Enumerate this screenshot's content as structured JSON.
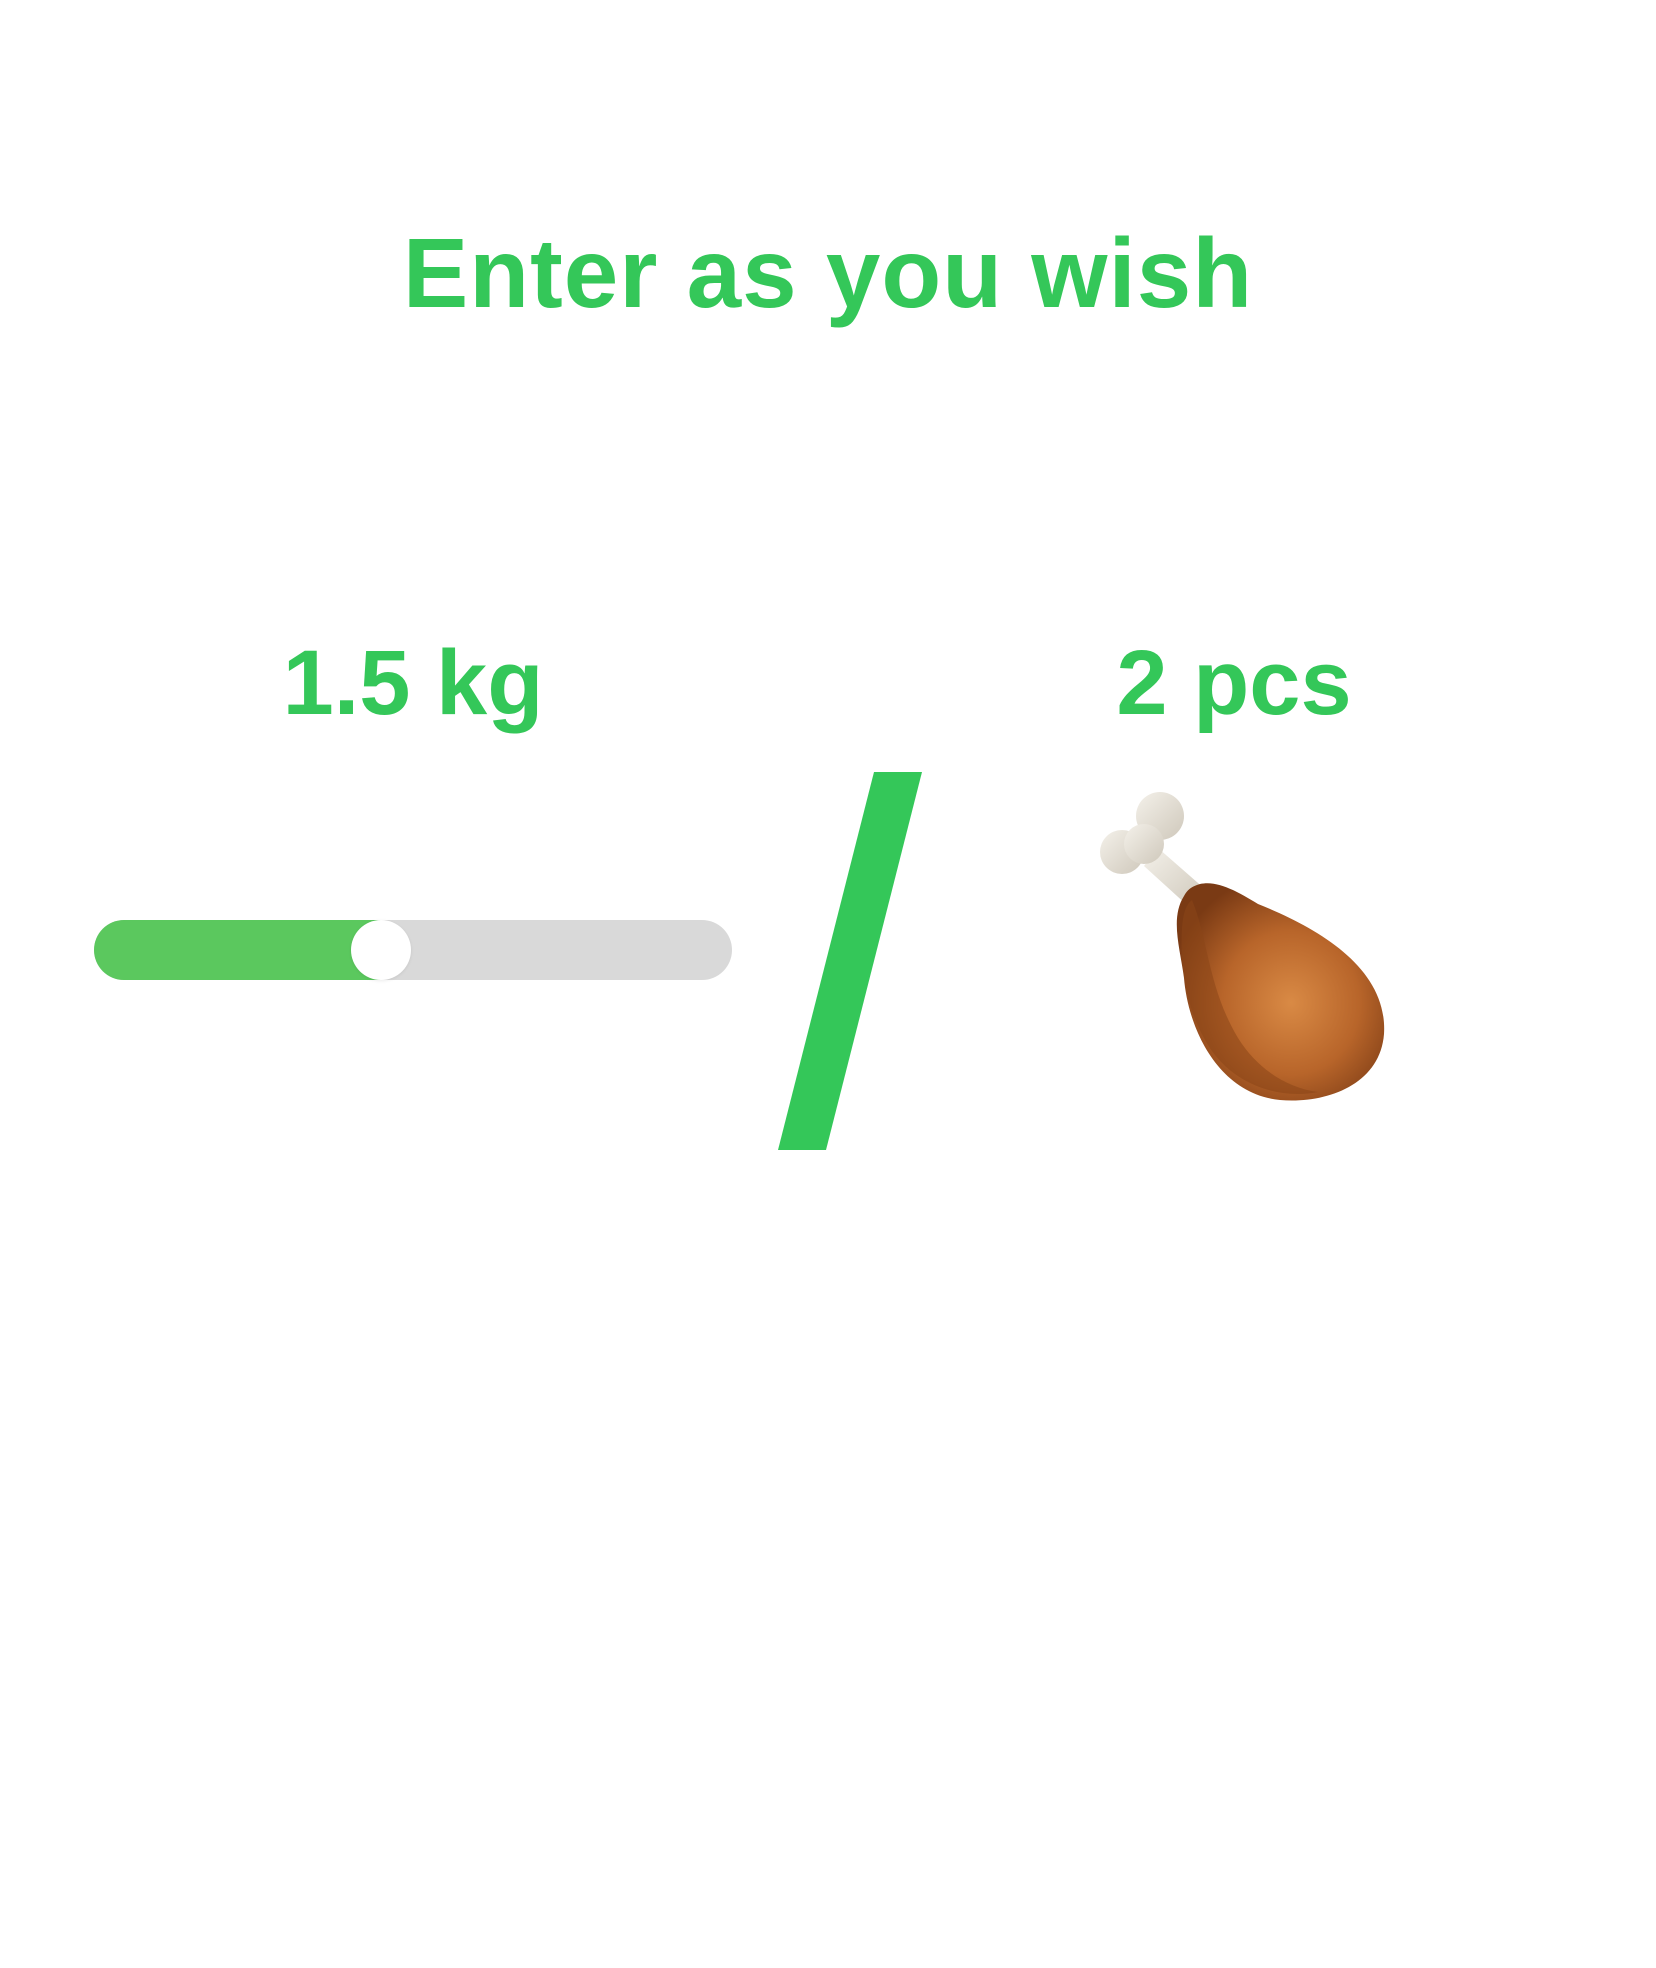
{
  "title": "Enter as you wish",
  "weight": {
    "label": "1.5 kg",
    "slider_fraction": 0.45
  },
  "pieces": {
    "label": "2 pcs",
    "icon": "drumstick-icon"
  },
  "colors": {
    "accent": "#34c759",
    "slider_fill": "#5bc85e",
    "slider_track": "#d9d9d9",
    "slider_thumb": "#ffffff"
  }
}
